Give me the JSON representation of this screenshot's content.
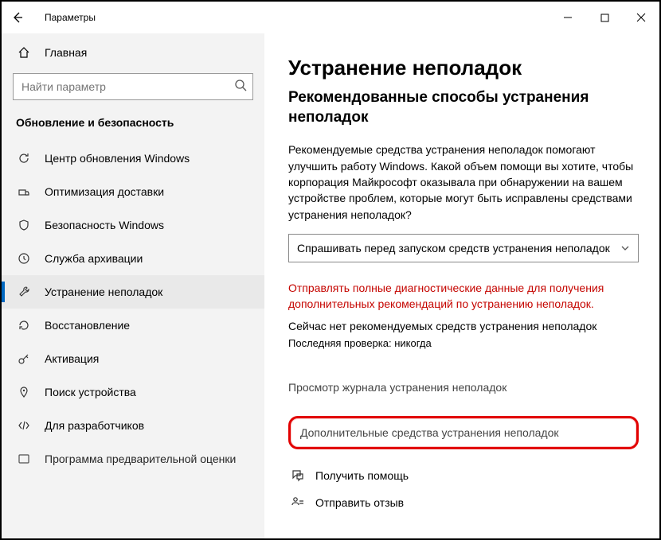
{
  "titlebar": {
    "app_title": "Параметры"
  },
  "sidebar": {
    "home": "Главная",
    "search_placeholder": "Найти параметр",
    "section_title": "Обновление и безопасность",
    "items": [
      {
        "label": "Центр обновления Windows"
      },
      {
        "label": "Оптимизация доставки"
      },
      {
        "label": "Безопасность Windows"
      },
      {
        "label": "Служба архивации"
      },
      {
        "label": "Устранение неполадок"
      },
      {
        "label": "Восстановление"
      },
      {
        "label": "Активация"
      },
      {
        "label": "Поиск устройства"
      },
      {
        "label": "Для разработчиков"
      },
      {
        "label": "Программа предварительной оценки"
      }
    ]
  },
  "content": {
    "h1": "Устранение неполадок",
    "h2": "Рекомендованные способы устранения неполадок",
    "desc": "Рекомендуемые средства устранения неполадок помогают улучшить работу Windows. Какой объем помощи вы хотите, чтобы корпорация Майкрософт оказывала при обнаружении на вашем устройстве проблем, которые могут быть исправлены средствами устранения неполадок?",
    "dropdown_value": "Спрашивать перед запуском средств устранения неполадок",
    "red_text": "Отправлять полные диагностические данные для получения дополнительных рекомендаций по устранению неполадок.",
    "none_text": "Сейчас нет рекомендуемых средств устранения неполадок",
    "last_check": "Последняя проверка: никогда",
    "history_link": "Просмотр журнала устранения неполадок",
    "additional_link": "Дополнительные средства устранения неполадок",
    "get_help": "Получить помощь",
    "feedback": "Отправить отзыв"
  }
}
